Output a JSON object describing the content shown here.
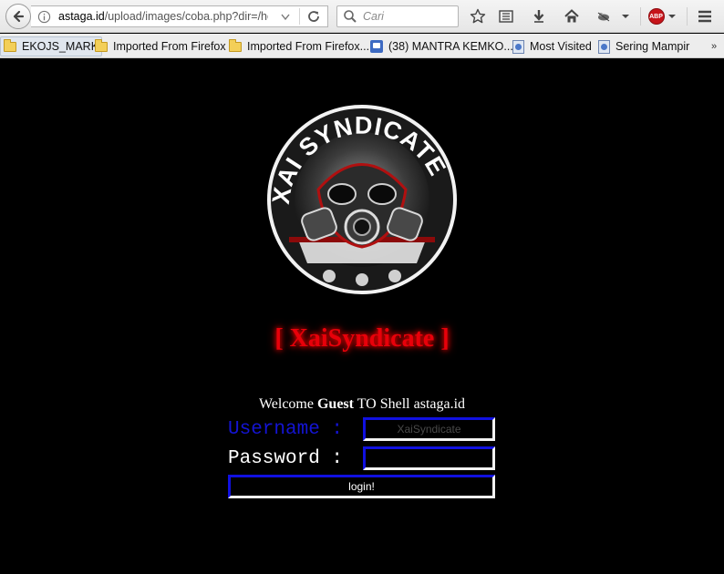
{
  "browser": {
    "url_host": "astaga.id",
    "url_path": "/upload/images/coba.php?dir=/hoi",
    "search_placeholder": "Cari",
    "abp_label": "ABP"
  },
  "bookmarks": [
    {
      "label": "EKOJS_MARK",
      "icon": "folder-icon"
    },
    {
      "label": "Imported From Firefox",
      "icon": "folder-icon"
    },
    {
      "label": "Imported From Firefox...",
      "icon": "folder-icon"
    },
    {
      "label": "(38) MANTRA KEMKO...",
      "icon": "youtube-icon"
    },
    {
      "label": "Most Visited",
      "icon": "page-icon"
    },
    {
      "label": "Sering Mampir",
      "icon": "page-icon"
    }
  ],
  "page": {
    "logo_text": "XAI SYNDICATE",
    "brand_title": "[ XaiSyndicate ]",
    "welcome_prefix": "Welcome",
    "welcome_user": "Guest",
    "welcome_suffix": "TO Shell astaga.id",
    "username_label": "Username :",
    "username_placeholder": "XaiSyndicate",
    "password_label": "Password :",
    "login_button": "login!"
  },
  "colors": {
    "background": "#000000",
    "brand_red": "#e8000a",
    "username_blue": "#1414d4",
    "field_border_blue": "#1010e0"
  }
}
